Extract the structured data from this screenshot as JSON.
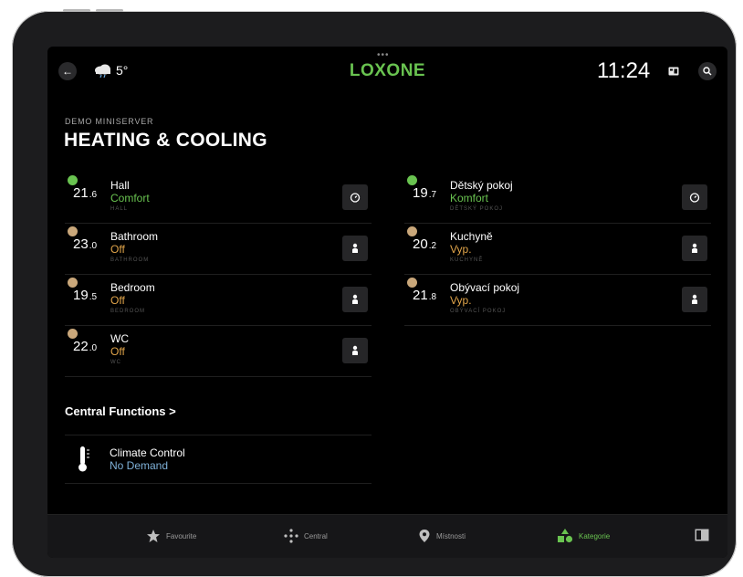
{
  "header": {
    "weather_temp": "5°",
    "logo": "LOXONE",
    "time": "11:24"
  },
  "page": {
    "miniserver": "DEMO MINISERVER",
    "title": "HEATING & COOLING"
  },
  "rooms_left": [
    {
      "temp_int": "21",
      "temp_dec": ".6",
      "name": "Hall",
      "state": "Comfort",
      "state_color": "#69c350",
      "sub": "HALL",
      "badge": "green",
      "button": "timer-icon"
    },
    {
      "temp_int": "23",
      "temp_dec": ".0",
      "name": "Bathroom",
      "state": "Off",
      "state_color": "#e0a44a",
      "sub": "BATHROOM",
      "badge": "tan",
      "button": "person-icon"
    },
    {
      "temp_int": "19",
      "temp_dec": ".5",
      "name": "Bedroom",
      "state": "Off",
      "state_color": "#e0a44a",
      "sub": "BEDROOM",
      "badge": "tan",
      "button": "person-icon"
    },
    {
      "temp_int": "22",
      "temp_dec": ".0",
      "name": "WC",
      "state": "Off",
      "state_color": "#e0a44a",
      "sub": "WC",
      "badge": "tan",
      "button": "person-icon"
    }
  ],
  "rooms_right": [
    {
      "temp_int": "19",
      "temp_dec": ".7",
      "name": "Dětský pokoj",
      "state": "Komfort",
      "state_color": "#69c350",
      "sub": "DĚTSKÝ POKOJ",
      "badge": "green",
      "button": "timer-icon"
    },
    {
      "temp_int": "20",
      "temp_dec": ".2",
      "name": "Kuchyně",
      "state": "Vyp.",
      "state_color": "#e0a44a",
      "sub": "KUCHYNĚ",
      "badge": "tan",
      "button": "person-icon"
    },
    {
      "temp_int": "21",
      "temp_dec": ".8",
      "name": "Obývací pokoj",
      "state": "Vyp.",
      "state_color": "#e0a44a",
      "sub": "OBÝVACÍ POKOJ",
      "badge": "tan",
      "button": "person-icon"
    }
  ],
  "central": {
    "heading": "Central Functions >",
    "item_name": "Climate Control",
    "item_state": "No Demand"
  },
  "tabbar": {
    "favourite": "Favourite",
    "central": "Central",
    "rooms": "Místnosti",
    "category": "Kategorie"
  },
  "colors": {
    "accent": "#69c350",
    "off": "#e0a44a",
    "info": "#7fb1d8"
  }
}
